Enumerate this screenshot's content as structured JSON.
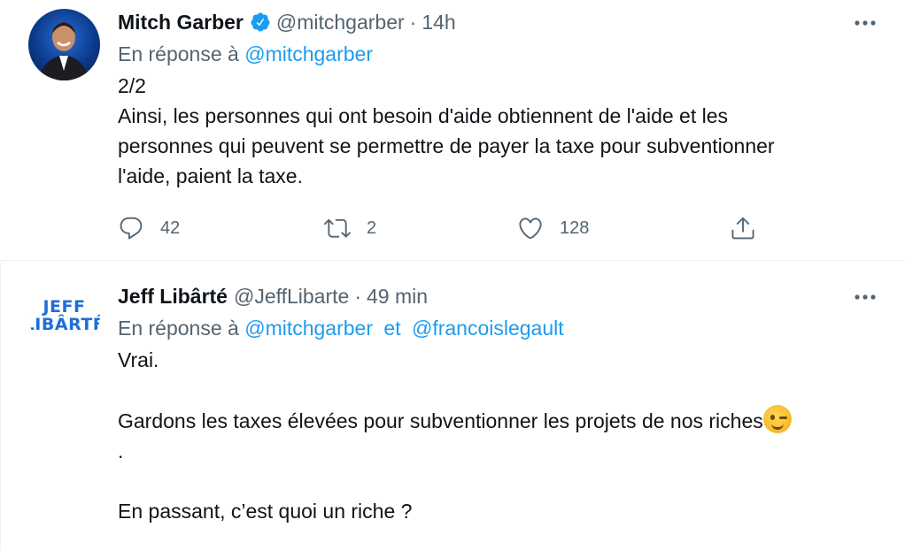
{
  "tweets": [
    {
      "author": "Mitch Garber",
      "handle": "@mitchgarber",
      "separator": "·",
      "time": "14h",
      "reply_prefix": "En réponse à",
      "reply_to": [
        "@mitchgarber"
      ],
      "lines": [
        "2/2",
        "Ainsi, les personnes qui ont besoin d'aide obtiennent de l'aide et les",
        "personnes qui peuvent se permettre de payer la taxe pour subventionner",
        "l'aide, paient la taxe."
      ],
      "replies": "42",
      "retweets": "2",
      "likes": "128"
    },
    {
      "author": "Jeff Libârté",
      "handle": "@JeffLibarte",
      "separator": "·",
      "time": "49 min",
      "reply_prefix": "En réponse à",
      "reply_to": [
        "@mitchgarber",
        "@francoislegault"
      ],
      "reply_joiner": "et",
      "avatar_logo": [
        "JEFF",
        "LIBÂRTÉ"
      ],
      "lines": [
        "Vrai.",
        "",
        "Gardons les taxes élevées pour subventionner les projets de nos riches",
        ".",
        "",
        "En passant, c’est quoi un riche ?"
      ]
    }
  ],
  "colors": {
    "link": "#1d9bf0",
    "muted": "#536471",
    "text": "#0f1419",
    "verified": "#1d9bf0"
  },
  "icons": [
    "verified-badge-icon",
    "more-icon",
    "reply-icon",
    "retweet-icon",
    "like-icon",
    "share-icon",
    "winking-face-emoji"
  ]
}
